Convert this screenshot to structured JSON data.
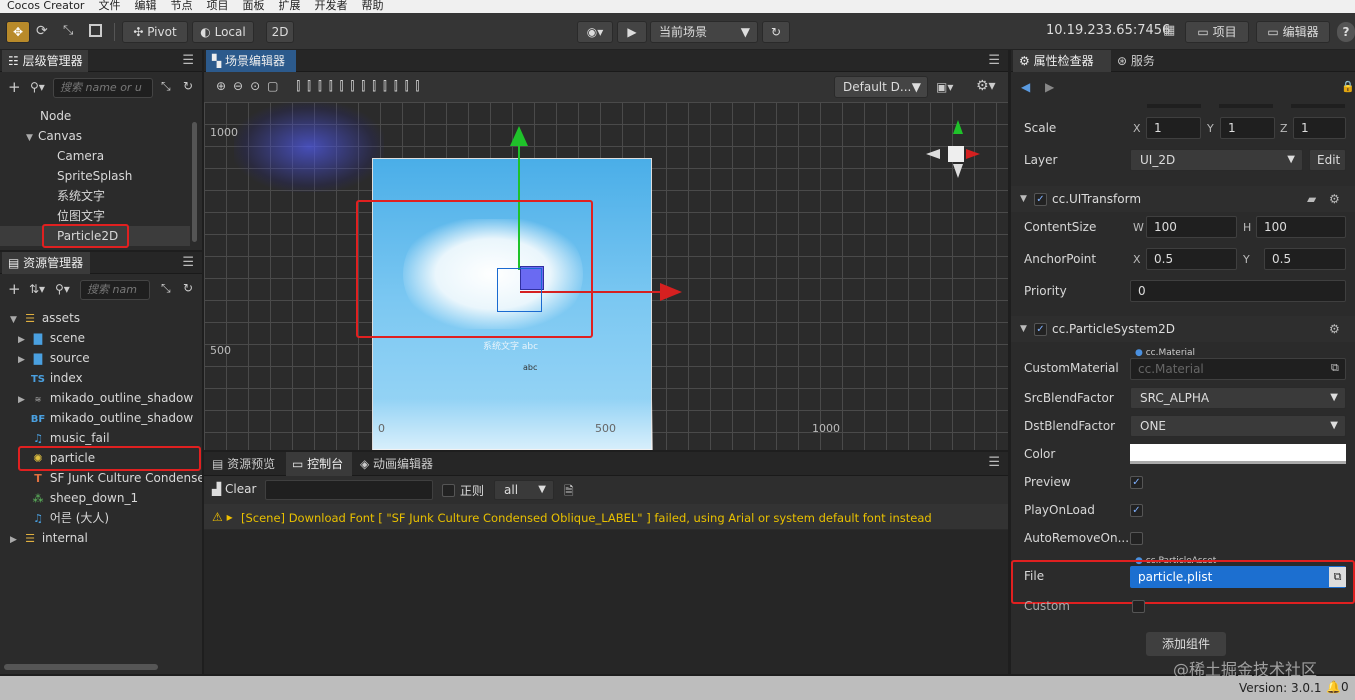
{
  "menubar": [
    "Cocos Creator",
    "文件",
    "编辑",
    "节点",
    "项目",
    "面板",
    "扩展",
    "开发者",
    "帮助"
  ],
  "toolbar": {
    "pivot_label": "Pivot",
    "local_label": "Local",
    "mode_2d": "2D",
    "scene_select": "当前场景",
    "ip": "10.19.233.65:7456",
    "project_btn": "项目",
    "editor_btn": "编辑器",
    "help": "?"
  },
  "hierarchy": {
    "tab": "层级管理器",
    "search_placeholder": "搜索 name or u",
    "items": [
      "Node",
      "Canvas",
      "Camera",
      "SpriteSplash",
      "系统文字",
      "位图文字",
      "Particle2D"
    ]
  },
  "assets": {
    "tab": "资源管理器",
    "search_placeholder": "搜索 nam",
    "items": [
      "assets",
      "scene",
      "source",
      "index",
      "mikado_outline_shadow",
      "mikado_outline_shadow",
      "music_fail",
      "particle",
      "SF Junk Culture Condensed",
      "sheep_down_1",
      "어른 (大人)",
      "internal"
    ],
    "badges": {
      "ts": "TS",
      "bf": "BF"
    }
  },
  "scene": {
    "tab": "场景编辑器",
    "preset": "Default D...",
    "labels": {
      "y1000": "1000",
      "y500": "500",
      "x0": "0",
      "x500": "500",
      "x1000": "1000",
      "small_text": "abc",
      "label_text": "系统文字 abc"
    }
  },
  "console": {
    "tabs": [
      "资源预览",
      "控制台",
      "动画编辑器"
    ],
    "clear": "Clear",
    "regex": "正则",
    "level": "all",
    "message": "[Scene] Download Font [ \"SF Junk Culture Condensed Oblique_LABEL\" ] failed, using Arial or system default font instead"
  },
  "inspector": {
    "tabs": [
      "属性检查器",
      "服务"
    ],
    "scale": {
      "label": "Scale",
      "x": "1",
      "y": "1",
      "z": "1"
    },
    "layer": {
      "label": "Layer",
      "value": "UI_2D",
      "edit": "Edit"
    },
    "ui_transform": {
      "title": "cc.UITransform",
      "content_size": "ContentSize",
      "w": "100",
      "h": "100",
      "anchor": "AnchorPoint",
      "ax": "0.5",
      "ay": "0.5",
      "priority": "Priority",
      "priority_val": "0"
    },
    "particle": {
      "title": "cc.ParticleSystem2D",
      "custom_material": "CustomMaterial",
      "material_tag": "cc.Material",
      "material_value": "cc.Material",
      "src_blend": "SrcBlendFactor",
      "src_value": "SRC_ALPHA",
      "dst_blend": "DstBlendFactor",
      "dst_value": "ONE",
      "color": "Color",
      "preview": "Preview",
      "play_on_load": "PlayOnLoad",
      "auto_remove": "AutoRemoveOn...",
      "file_tag": "cc.ParticleAsset",
      "file": "File",
      "file_value": "particle.plist",
      "custom": "Custom"
    },
    "add_component": "添加组件",
    "axis": {
      "x": "X",
      "y": "Y",
      "z": "Z",
      "w": "W",
      "h": "H"
    }
  },
  "status": {
    "version": "Version: 3.0.1",
    "bell": "0",
    "watermark": "@稀土掘金技术社区"
  },
  "colors": {
    "accent": "#2c5a8c",
    "highlight": "#e02020",
    "selection": "#1c6fd0"
  }
}
